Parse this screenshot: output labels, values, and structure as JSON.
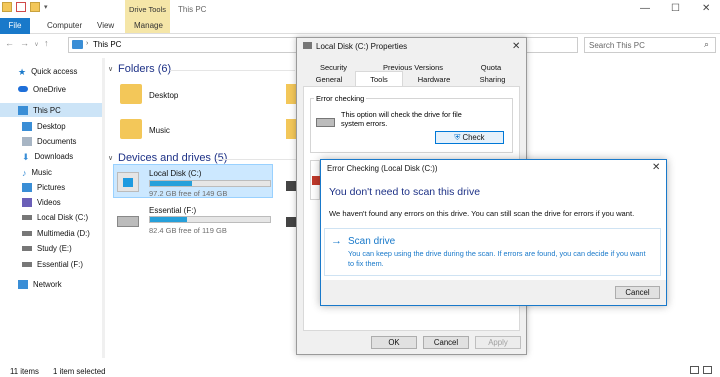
{
  "window": {
    "title": "This PC",
    "context_tab": "Drive Tools",
    "controls": {
      "minimize": "—",
      "maximize": "☐",
      "close": "✕"
    }
  },
  "ribbon": {
    "file_tab": "File",
    "tabs": [
      "Computer",
      "View",
      "Manage"
    ]
  },
  "address": {
    "path": "This PC",
    "search_placeholder": "Search This PC"
  },
  "sidebar": {
    "items": [
      {
        "label": "Quick access",
        "icon": "star-icon",
        "color": "#1979ca"
      },
      {
        "label": "OneDrive",
        "icon": "cloud-icon",
        "color": "#1e6fd9"
      },
      {
        "label": "This PC",
        "icon": "computer-icon",
        "color": "#3a8ed6"
      },
      {
        "label": "Desktop",
        "icon": "desktop-icon",
        "color": "#3a8ed6"
      },
      {
        "label": "Documents",
        "icon": "documents-icon",
        "color": "#a7b5c4"
      },
      {
        "label": "Downloads",
        "icon": "download-icon",
        "color": "#3a8ed6"
      },
      {
        "label": "Music",
        "icon": "music-icon",
        "color": "#3a8ed6"
      },
      {
        "label": "Pictures",
        "icon": "pictures-icon",
        "color": "#3a8ed6"
      },
      {
        "label": "Videos",
        "icon": "videos-icon",
        "color": "#6b5fb8"
      },
      {
        "label": "Local Disk (C:)",
        "icon": "drive-icon",
        "color": "#777777"
      },
      {
        "label": "Multimedia (D:)",
        "icon": "drive-icon",
        "color": "#777777"
      },
      {
        "label": "Study (E:)",
        "icon": "drive-icon",
        "color": "#777777"
      },
      {
        "label": "Essential (F:)",
        "icon": "drive-icon",
        "color": "#777777"
      },
      {
        "label": "Network",
        "icon": "network-icon",
        "color": "#3a8ed6"
      }
    ]
  },
  "content": {
    "folders_heading": "Folders (6)",
    "folders": [
      {
        "label": "Desktop"
      },
      {
        "label": "Music"
      }
    ],
    "drives_heading": "Devices and drives (5)",
    "drives": [
      {
        "label": "Local Disk (C:)",
        "free": "97.2 GB free of 149 GB",
        "used_fraction": 0.35
      },
      {
        "label": "Essential (F:)",
        "free": "82.4 GB free of 119 GB",
        "used_fraction": 0.31
      }
    ]
  },
  "status": {
    "items": "11 items",
    "selected": "1 item selected"
  },
  "properties": {
    "title": "Local Disk (C:) Properties",
    "tabs_row1": [
      "Security",
      "Previous Versions",
      "Quota"
    ],
    "tabs_row2": [
      "General",
      "Tools",
      "Hardware",
      "Sharing"
    ],
    "active_tab": "Tools",
    "error_group_title": "Error checking",
    "error_desc": "This option will check the drive for file system errors.",
    "check_button": "Check",
    "buttons": {
      "ok": "OK",
      "cancel": "Cancel",
      "apply": "Apply"
    }
  },
  "error_dialog": {
    "title": "Error Checking (Local Disk (C:))",
    "heading": "You don't need to scan this drive",
    "body": "We haven't found any errors on this drive. You can still scan the drive for errors if you want.",
    "scan_title": "Scan drive",
    "scan_desc": "You can keep using the drive during the scan. If errors are found, you can decide if you want to fix them.",
    "cancel": "Cancel",
    "accent_color": "#1979ca"
  }
}
